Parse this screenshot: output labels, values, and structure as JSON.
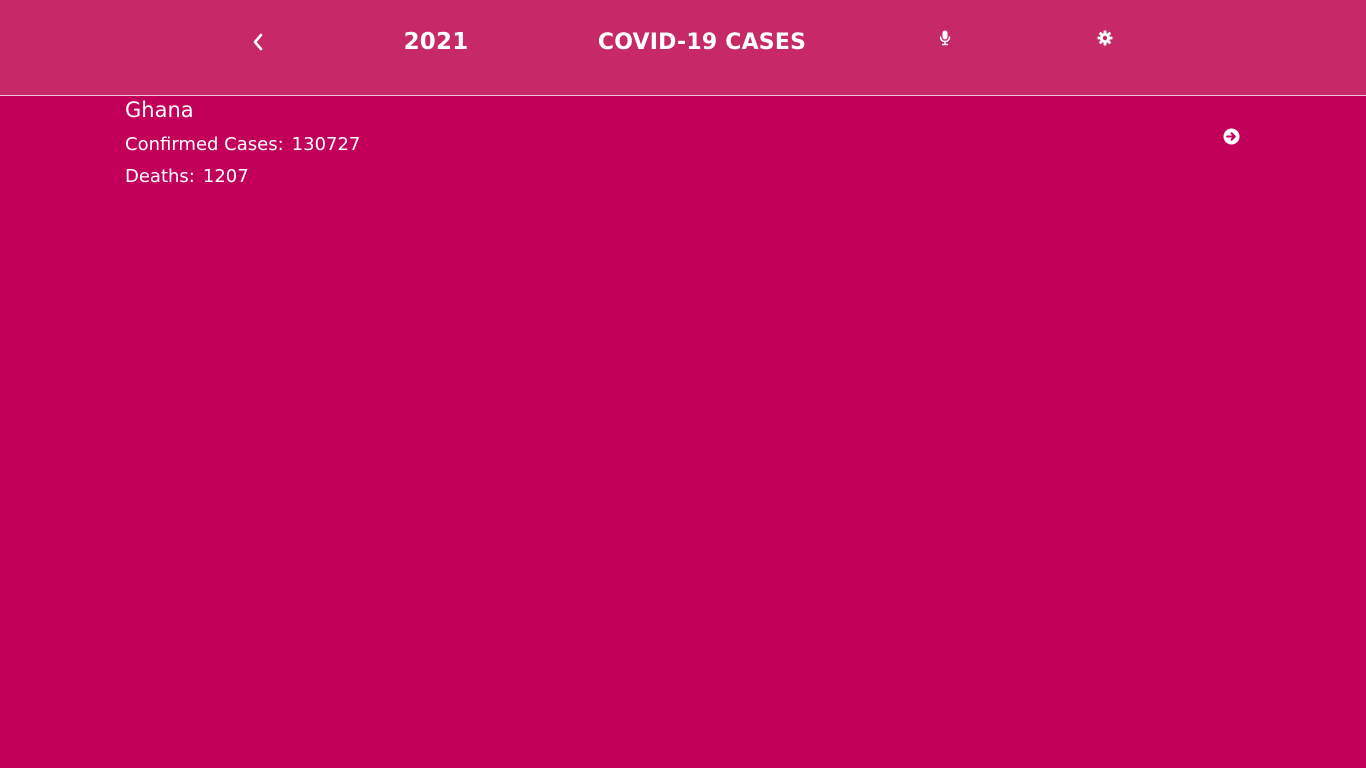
{
  "header": {
    "year": "2021",
    "title": "COVID-19 CASES",
    "icons": {
      "back": "chevron-left-icon",
      "mic": "microphone-icon",
      "settings": "gear-icon"
    }
  },
  "country": {
    "name": "Ghana",
    "confirmed_label": "Confirmed Cases:",
    "confirmed_value": "130727",
    "deaths_label": "Deaths:",
    "deaths_value": "1207",
    "detail_icon": "arrow-circle-right-icon"
  },
  "colors": {
    "background": "#c2005a",
    "header": "#c62868",
    "text": "#ffffff"
  }
}
